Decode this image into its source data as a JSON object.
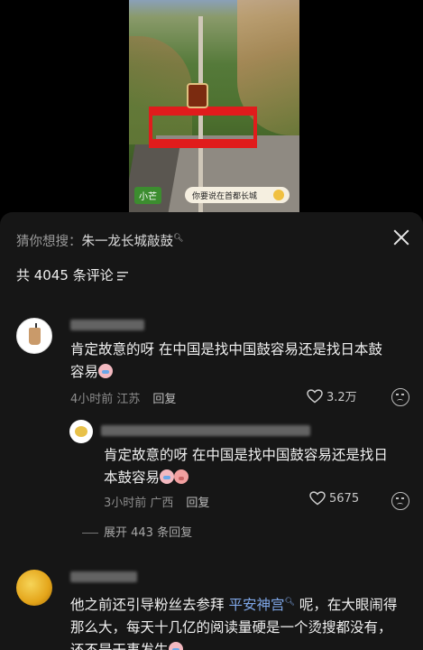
{
  "video": {
    "tag_left": "小芒",
    "tag_right": "你要说在首都长城"
  },
  "panel": {
    "suggest_prefix": "猜你想搜：",
    "suggest_keyword": "朱一龙长城敲鼓",
    "comment_count": "共 4045 条评论"
  },
  "comments": [
    {
      "text_line1": "肯定故意的呀 在中国是找中国鼓容易还是找日本鼓",
      "text_line2": "容易",
      "time": "4小时前 江苏",
      "reply": "回复",
      "likes": "3.2万"
    },
    {
      "text_line1": "肯定故意的呀 在中国是找中国鼓容易还是找日",
      "text_line2": "本鼓容易",
      "time": "3小时前 广西",
      "reply": "回复",
      "likes": "5675",
      "expand": "展开 443 条回复"
    },
    {
      "text_line1_a": "他之前还引导粉丝去参拜 ",
      "text_line1_link": "平安神宫",
      "text_line1_b": " 呢，在大眼闹得",
      "text_line2": "那么大，每天十几亿的阅读量硬是一个烫搜都没有，",
      "text_line3": "还不是干事发生"
    }
  ],
  "icons": [
    "close-icon",
    "sort-icon",
    "heart-icon",
    "dislike-icon",
    "search-icon"
  ]
}
